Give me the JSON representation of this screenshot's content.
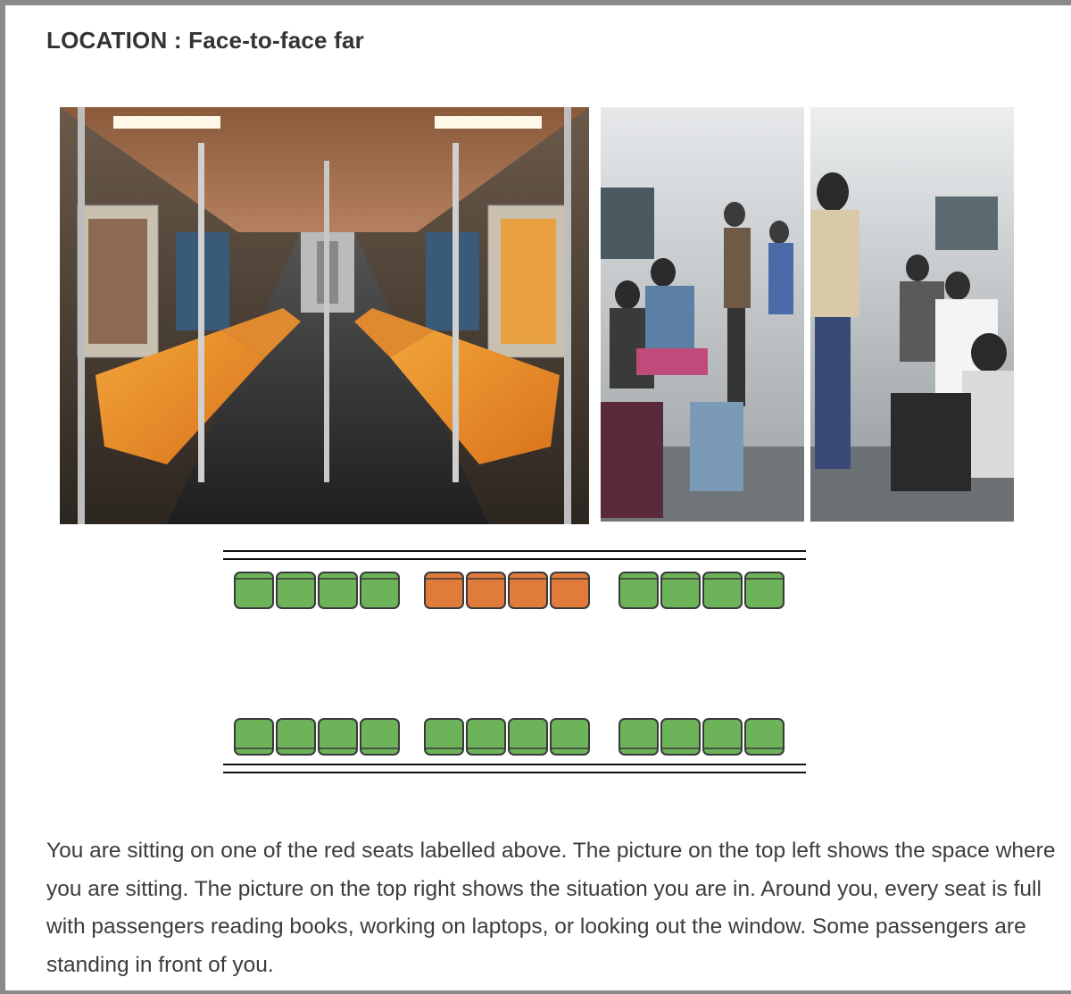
{
  "title": "LOCATION : Face-to-face far",
  "images": {
    "left": "empty-subway-car-photo",
    "right_a": "crowded-subway-car-photo-1",
    "right_b": "crowded-subway-car-photo-2"
  },
  "seat_map": {
    "colors": {
      "occupied": "#6cb35a",
      "target": "#e07b3c",
      "outline": "#3a3a3a",
      "rail": "#111111"
    },
    "top_row": [
      {
        "group": 1,
        "seats": [
          "green",
          "green",
          "green",
          "green"
        ]
      },
      {
        "group": 2,
        "seats": [
          "orange",
          "orange",
          "orange",
          "orange"
        ]
      },
      {
        "group": 3,
        "seats": [
          "green",
          "green",
          "green",
          "green"
        ]
      }
    ],
    "bottom_row": [
      {
        "group": 1,
        "seats": [
          "green",
          "green",
          "green",
          "green"
        ]
      },
      {
        "group": 2,
        "seats": [
          "green",
          "green",
          "green",
          "green"
        ]
      },
      {
        "group": 3,
        "seats": [
          "green",
          "green",
          "green",
          "green"
        ]
      }
    ]
  },
  "description": "You are sitting on one of the red seats labelled above. The picture on the top left shows the space where you are sitting. The picture on the top right shows the situation you are in. Around you, every seat is full with passengers reading books, working on laptops, or looking out the window. Some passengers are standing in front of you."
}
